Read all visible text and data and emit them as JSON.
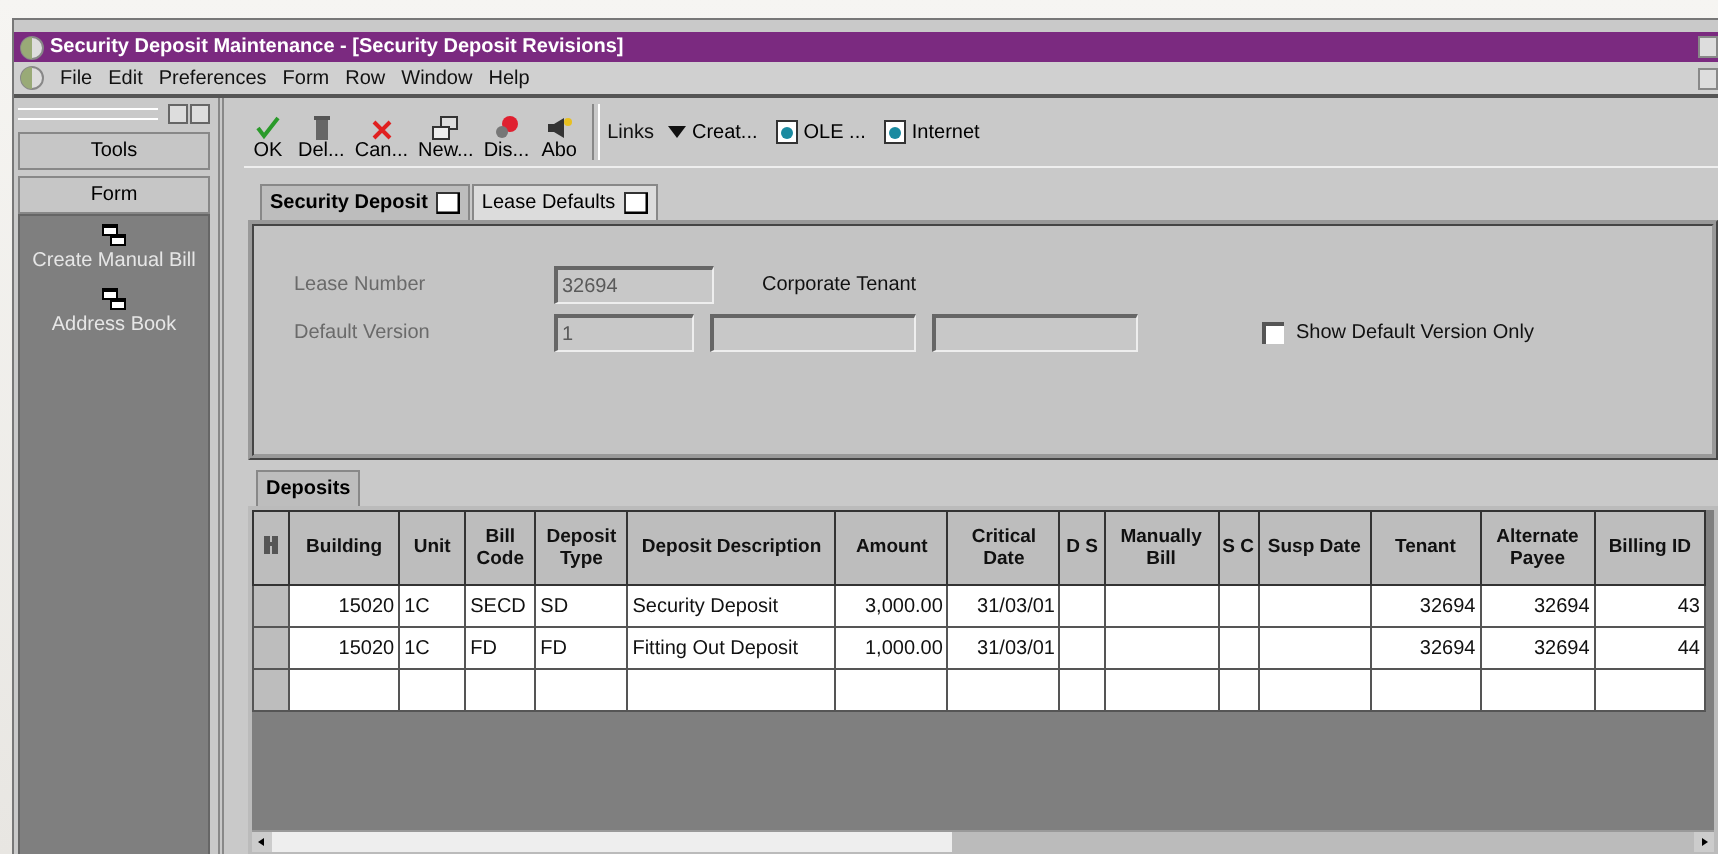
{
  "window": {
    "title": "Security Deposit Maintenance - [Security Deposit Revisions]"
  },
  "menu": [
    "File",
    "Edit",
    "Preferences",
    "Form",
    "Row",
    "Window",
    "Help"
  ],
  "sidebar": {
    "buttons": [
      "Tools",
      "Form"
    ],
    "items": [
      "Create Manual Bill",
      "Address Book"
    ]
  },
  "toolbar": {
    "buttons": [
      {
        "label": "OK",
        "kind": "ok"
      },
      {
        "label": "Del...",
        "kind": "delete"
      },
      {
        "label": "Can...",
        "kind": "cancel"
      },
      {
        "label": "New...",
        "kind": "new"
      },
      {
        "label": "Dis...",
        "kind": "display"
      },
      {
        "label": "Abo",
        "kind": "about"
      }
    ],
    "links": "Links",
    "dropdown": "Creat...",
    "docs": [
      "OLE ...",
      "Internet"
    ]
  },
  "tabs": [
    {
      "label": "Security Deposit",
      "selected": true
    },
    {
      "label": "Lease Defaults",
      "selected": false
    }
  ],
  "form": {
    "lease_number": {
      "label": "Lease Number",
      "value": "32694",
      "disabled": true
    },
    "lease_name": "Corporate Tenant",
    "default_version": {
      "label": "Default Version",
      "disabled": true,
      "fields": [
        {
          "value": "1"
        },
        {
          "kind": "blank"
        },
        {
          "kind": "blank"
        }
      ]
    },
    "checkbox": {
      "label": "Show Default Version Only",
      "checked": false
    }
  },
  "grid": {
    "tab": "Deposits",
    "columns": [
      "Building",
      "Unit",
      "Bill Code",
      "Deposit Type",
      "Deposit Description",
      "Amount",
      "Critical Date",
      "D S",
      "Manually Bill",
      "S C",
      "Susp Date",
      "Tenant",
      "Alternate Payee",
      "Billing ID"
    ],
    "rows": [
      [
        "15020",
        "1C",
        "SECD",
        "SD",
        "Security Deposit",
        "3,000.00",
        "31/03/01",
        null,
        null,
        null,
        null,
        "32694",
        "32694",
        "43"
      ],
      [
        "15020",
        "1C",
        "FD",
        "FD",
        "Fitting Out Deposit",
        "1,000.00",
        "31/03/01",
        null,
        null,
        null,
        null,
        "32694",
        "32694",
        "44"
      ]
    ]
  }
}
